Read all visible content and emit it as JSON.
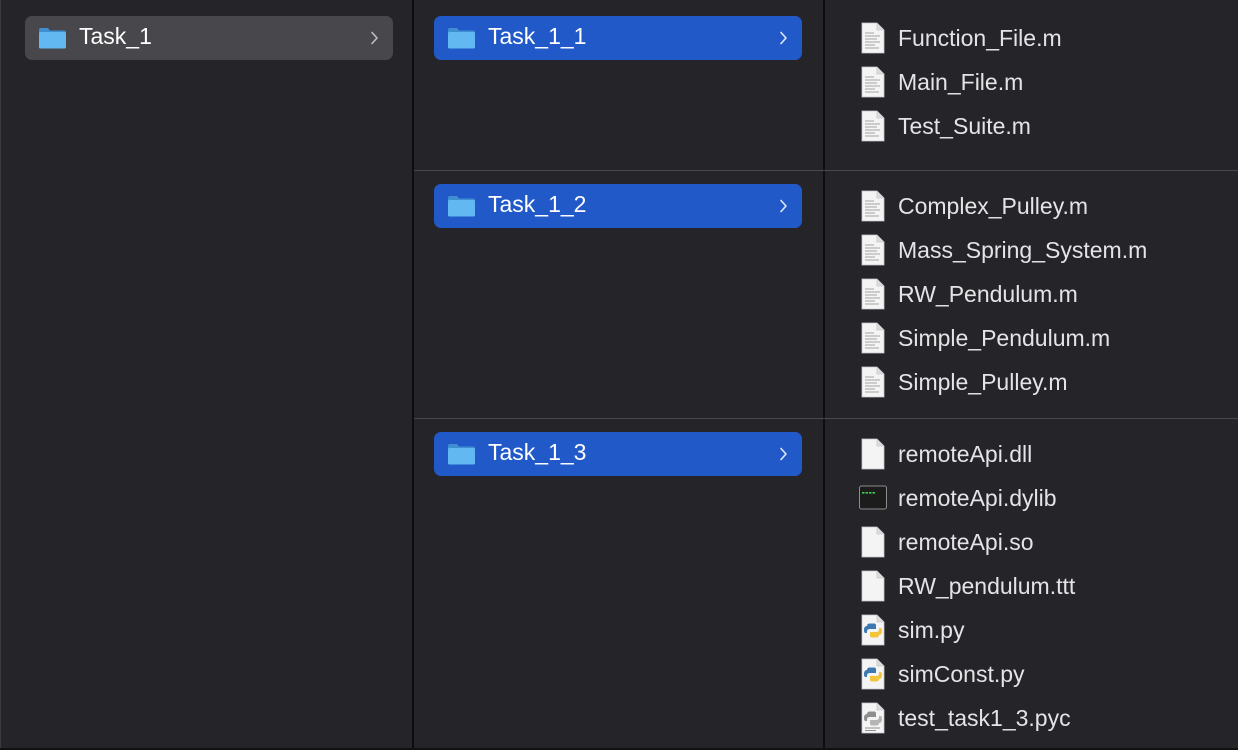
{
  "columns": {
    "col1": {
      "folders": [
        {
          "name": "Task_1",
          "selected": true,
          "selection_style": "inactive"
        }
      ]
    },
    "col2": {
      "folders": [
        {
          "name": "Task_1_1",
          "selected": true,
          "selection_style": "active"
        },
        {
          "name": "Task_1_2",
          "selected": true,
          "selection_style": "active"
        },
        {
          "name": "Task_1_3",
          "selected": true,
          "selection_style": "active"
        }
      ]
    },
    "col3": {
      "groups": [
        {
          "files": [
            {
              "name": "Function_File.m",
              "icon": "document-icon"
            },
            {
              "name": "Main_File.m",
              "icon": "document-icon"
            },
            {
              "name": "Test_Suite.m",
              "icon": "document-icon"
            }
          ]
        },
        {
          "files": [
            {
              "name": "Complex_Pulley.m",
              "icon": "document-icon"
            },
            {
              "name": "Mass_Spring_System.m",
              "icon": "document-icon"
            },
            {
              "name": "RW_Pendulum.m",
              "icon": "document-icon"
            },
            {
              "name": "Simple_Pendulum.m",
              "icon": "document-icon"
            },
            {
              "name": "Simple_Pulley.m",
              "icon": "document-icon"
            }
          ]
        },
        {
          "files": [
            {
              "name": "remoteApi.dll",
              "icon": "blank-file-icon"
            },
            {
              "name": "remoteApi.dylib",
              "icon": "terminal-exec-icon"
            },
            {
              "name": "remoteApi.so",
              "icon": "blank-file-icon"
            },
            {
              "name": "RW_pendulum.ttt",
              "icon": "blank-file-icon"
            },
            {
              "name": "sim.py",
              "icon": "python-file-icon"
            },
            {
              "name": "simConst.py",
              "icon": "python-file-icon"
            },
            {
              "name": "test_task1_3.pyc",
              "icon": "compiled-python-icon"
            }
          ]
        }
      ]
    }
  },
  "colors": {
    "active_selection": "#2259c9",
    "inactive_selection": "#48474b",
    "background": "#252428",
    "folder_blue": "#5bb4ee"
  }
}
